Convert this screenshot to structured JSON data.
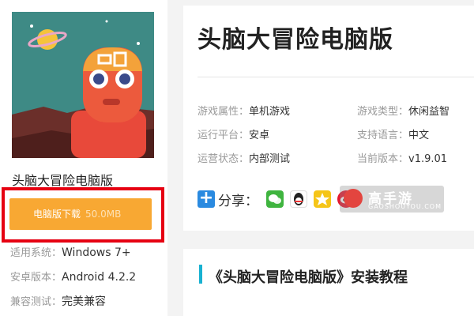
{
  "app": {
    "name": "头脑大冒险电脑版",
    "title": "头脑大冒险电脑版"
  },
  "download": {
    "label": "电脑版下载",
    "size": "50.0MB"
  },
  "specs": [
    {
      "label": "适用系统：",
      "value": "Windows 7+"
    },
    {
      "label": "安卓版本：",
      "value": "Android 4.2.2"
    },
    {
      "label": "兼容测试：",
      "value": "完美兼容"
    }
  ],
  "attributes": [
    {
      "label": "游戏属性：",
      "value": "单机游戏"
    },
    {
      "label": "游戏类型：",
      "value": "休闲益智"
    },
    {
      "label": "运行平台：",
      "value": "安卓"
    },
    {
      "label": "支持语言：",
      "value": "中文"
    },
    {
      "label": "运营状态：",
      "value": "内部测试"
    },
    {
      "label": "当前版本：",
      "value": "v1.9.01"
    }
  ],
  "share": {
    "label": "分享：",
    "icons": [
      "wechat-icon",
      "qq-icon",
      "qzone-icon",
      "weibo-icon"
    ]
  },
  "watermark": {
    "text": "高手游",
    "sub": "GAOSHOUYOU.COM"
  },
  "tutorial": {
    "title": "《头脑大冒险电脑版》安装教程"
  },
  "colors": {
    "download_button": "#f8a833",
    "highlight_frame": "#e60012",
    "accent_bar": "#18b1d1"
  }
}
